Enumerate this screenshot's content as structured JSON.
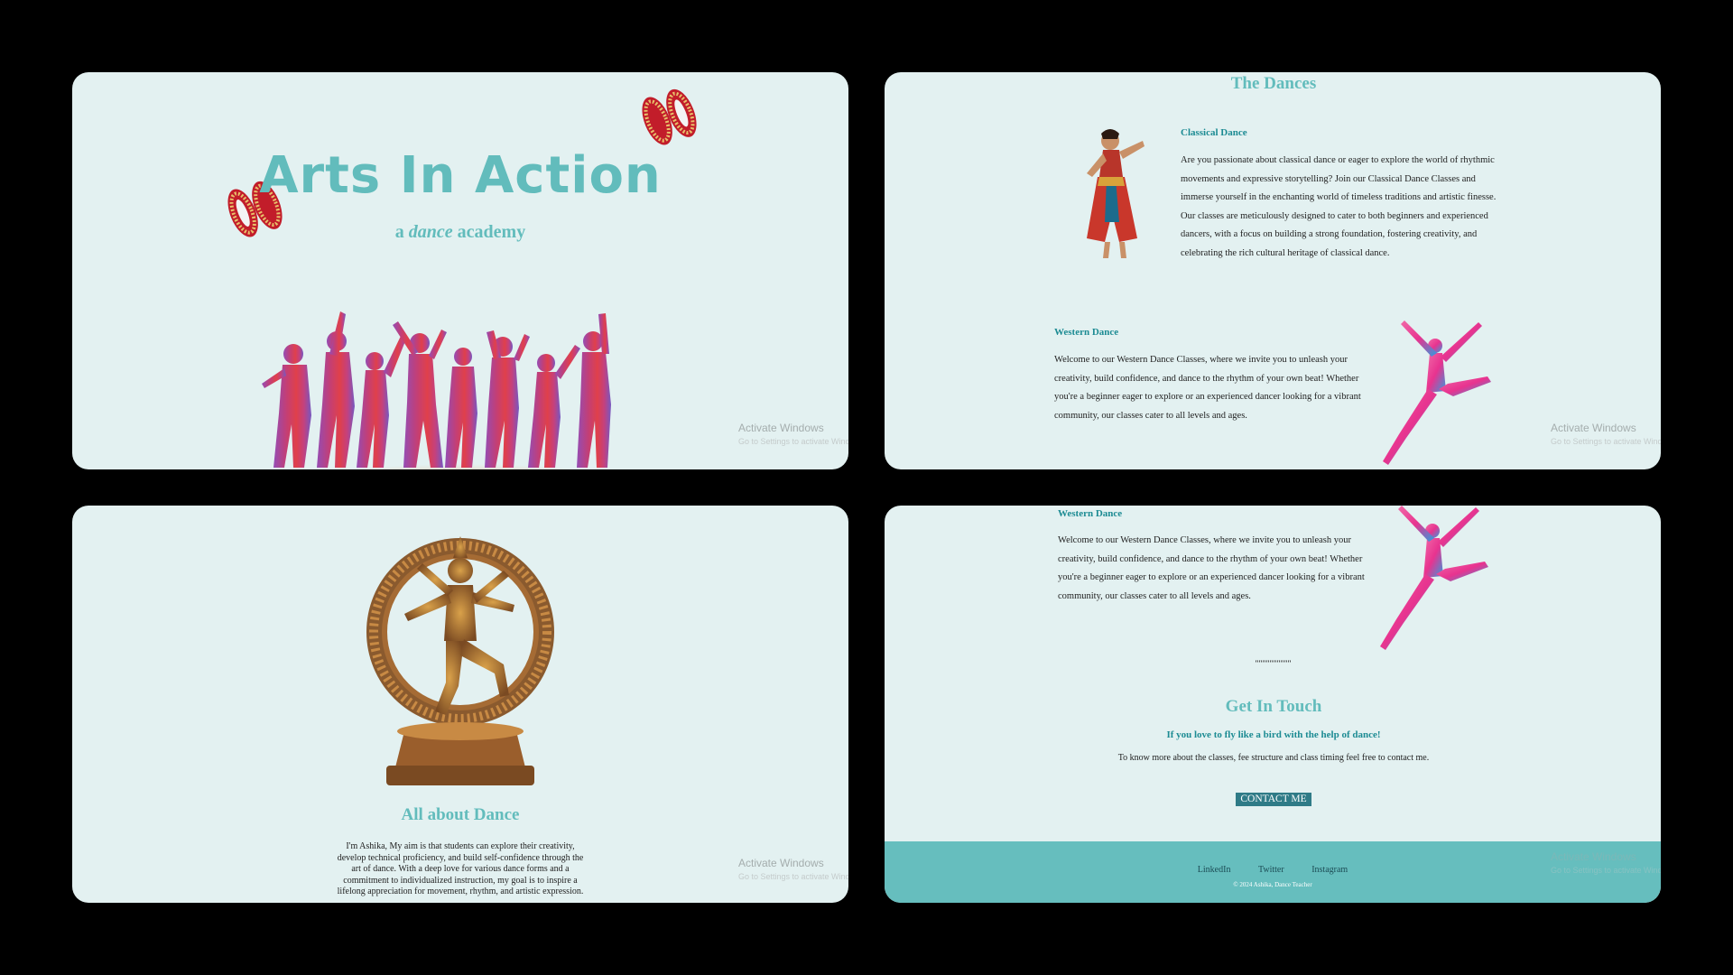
{
  "colors": {
    "background": "#000000",
    "panel": "#e3f1f1",
    "accent": "#62bcbc",
    "heading_dark": "#1c8b93",
    "footer": "#66bebe"
  },
  "hero": {
    "title": "Arts In Action",
    "tagline_prefix": "a",
    "tagline_em": "dance",
    "tagline_suffix": "academy"
  },
  "dances": {
    "section_title": "The Dances",
    "classical": {
      "heading": "Classical Dance",
      "lines": [
        "Are you passionate about classical dance or eager to explore the world of rhythmic",
        "movements and expressive storytelling? Join our Classical Dance Classes and",
        "immerse yourself in the enchanting world of timeless traditions and artistic finesse.",
        "Our classes are meticulously designed to cater to both beginners and experienced",
        "dancers, with a focus on building a strong foundation, fostering creativity, and",
        "celebrating the rich cultural heritage of classical dance."
      ]
    },
    "western": {
      "heading": "Western Dance",
      "lines": [
        "Welcome to our Western Dance Classes, where we invite you to unleash your",
        "creativity, build confidence, and dance to the rhythm of your own beat! Whether",
        "you're a beginner eager to explore or an experienced dancer looking for a vibrant",
        "community, our classes cater to all levels and ages."
      ]
    }
  },
  "about": {
    "title": "All about Dance",
    "lines": [
      "I'm Ashika, My aim is that students can explore their creativity,",
      "develop technical proficiency, and build self-confidence through the",
      "art of dance. With a deep love for various dance forms and a",
      "commitment to individualized instruction, my goal is to inspire a",
      "lifelong appreciation for movement, rhythm, and artistic expression."
    ]
  },
  "contact": {
    "divider": "\"\"\"\"\"\"\"\"\"\"",
    "title": "Get In Touch",
    "subtitle": "If you love to fly like a bird with the help of dance!",
    "text": "To know more about the classes, fee structure and class timing feel free to contact me.",
    "button_label": "CONTACT ME"
  },
  "footer": {
    "links": [
      "LinkedIn",
      "Twitter",
      "Instagram"
    ],
    "copyright": "© 2024 Ashika, Dance Teacher"
  },
  "watermark": {
    "line1": "Activate Windows",
    "line2": "Go to Settings to activate Windows."
  },
  "icons": [
    "ghungroo-anklet-icon",
    "dancer-silhouettes-image",
    "classical-dancer-image",
    "leaping-dancer-image",
    "nataraja-statue-image"
  ]
}
